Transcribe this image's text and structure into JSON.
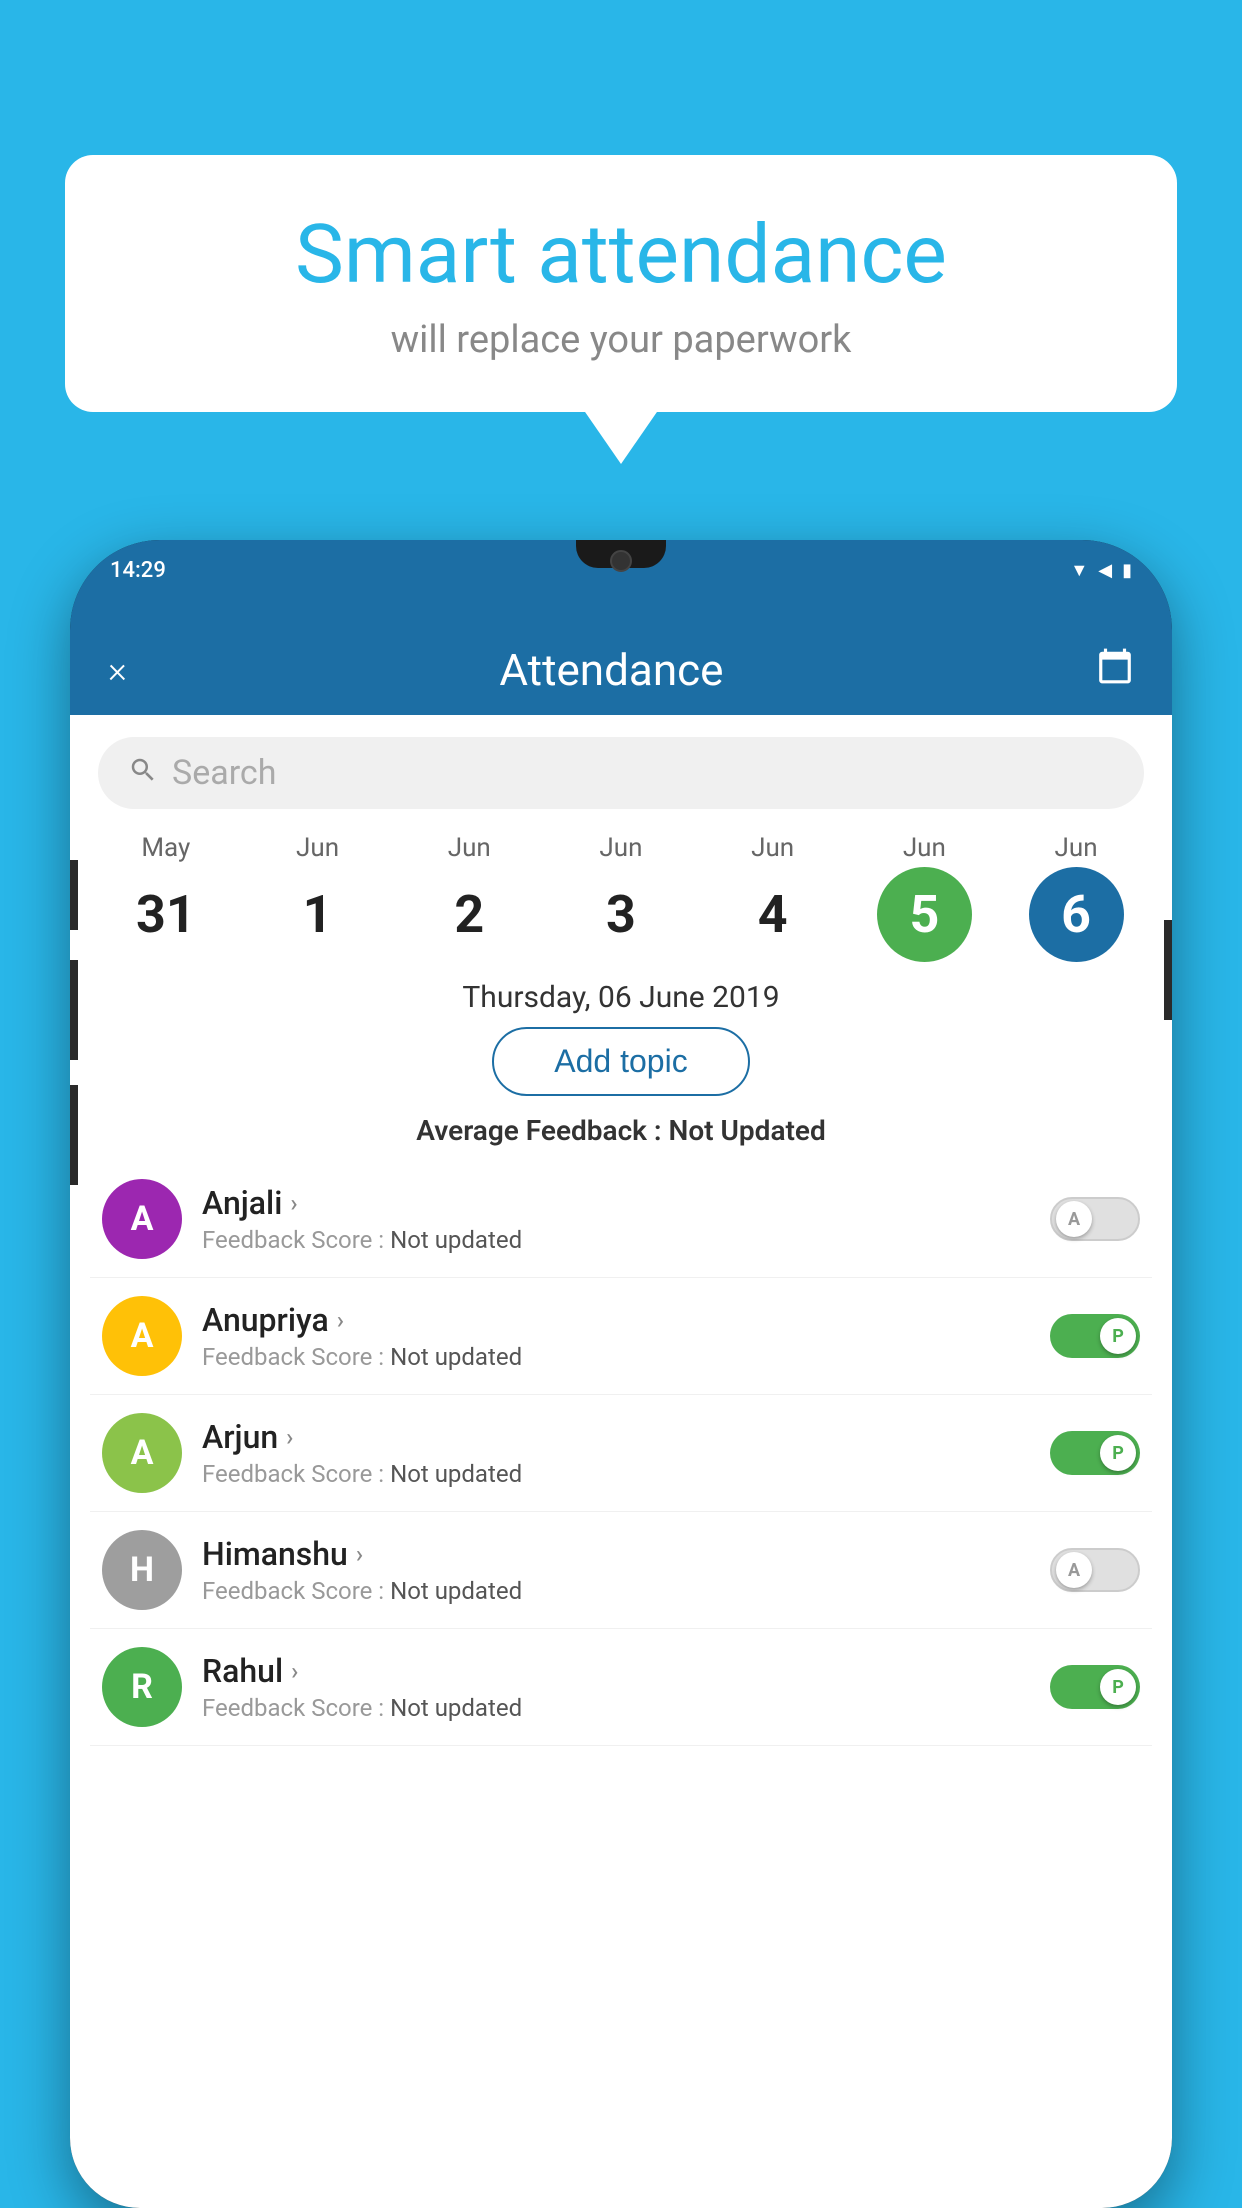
{
  "background_color": "#29B6E8",
  "bubble": {
    "title": "Smart attendance",
    "subtitle": "will replace your paperwork"
  },
  "status_bar": {
    "time": "14:29"
  },
  "header": {
    "title": "Attendance",
    "close_label": "×",
    "calendar_label": "📅"
  },
  "search": {
    "placeholder": "Search"
  },
  "calendar": {
    "days": [
      {
        "month": "May",
        "date": "31",
        "state": "normal"
      },
      {
        "month": "Jun",
        "date": "1",
        "state": "normal"
      },
      {
        "month": "Jun",
        "date": "2",
        "state": "normal"
      },
      {
        "month": "Jun",
        "date": "3",
        "state": "normal"
      },
      {
        "month": "Jun",
        "date": "4",
        "state": "normal"
      },
      {
        "month": "Jun",
        "date": "5",
        "state": "today"
      },
      {
        "month": "Jun",
        "date": "6",
        "state": "selected"
      }
    ]
  },
  "selected_date_label": "Thursday, 06 June 2019",
  "add_topic_label": "Add topic",
  "avg_feedback_label": "Average Feedback :",
  "avg_feedback_value": "Not Updated",
  "students": [
    {
      "name": "Anjali",
      "avatar_letter": "A",
      "avatar_color": "#9C27B0",
      "feedback_label": "Feedback Score :",
      "feedback_value": "Not updated",
      "toggle": "off",
      "toggle_letter": "A"
    },
    {
      "name": "Anupriya",
      "avatar_letter": "A",
      "avatar_color": "#FFC107",
      "feedback_label": "Feedback Score :",
      "feedback_value": "Not updated",
      "toggle": "on",
      "toggle_letter": "P"
    },
    {
      "name": "Arjun",
      "avatar_letter": "A",
      "avatar_color": "#8BC34A",
      "feedback_label": "Feedback Score :",
      "feedback_value": "Not updated",
      "toggle": "on",
      "toggle_letter": "P"
    },
    {
      "name": "Himanshu",
      "avatar_letter": "H",
      "avatar_color": "#9E9E9E",
      "feedback_label": "Feedback Score :",
      "feedback_value": "Not updated",
      "toggle": "off",
      "toggle_letter": "A"
    },
    {
      "name": "Rahul",
      "avatar_letter": "R",
      "avatar_color": "#4CAF50",
      "feedback_label": "Feedback Score :",
      "feedback_value": "Not updated",
      "toggle": "on",
      "toggle_letter": "P"
    }
  ]
}
